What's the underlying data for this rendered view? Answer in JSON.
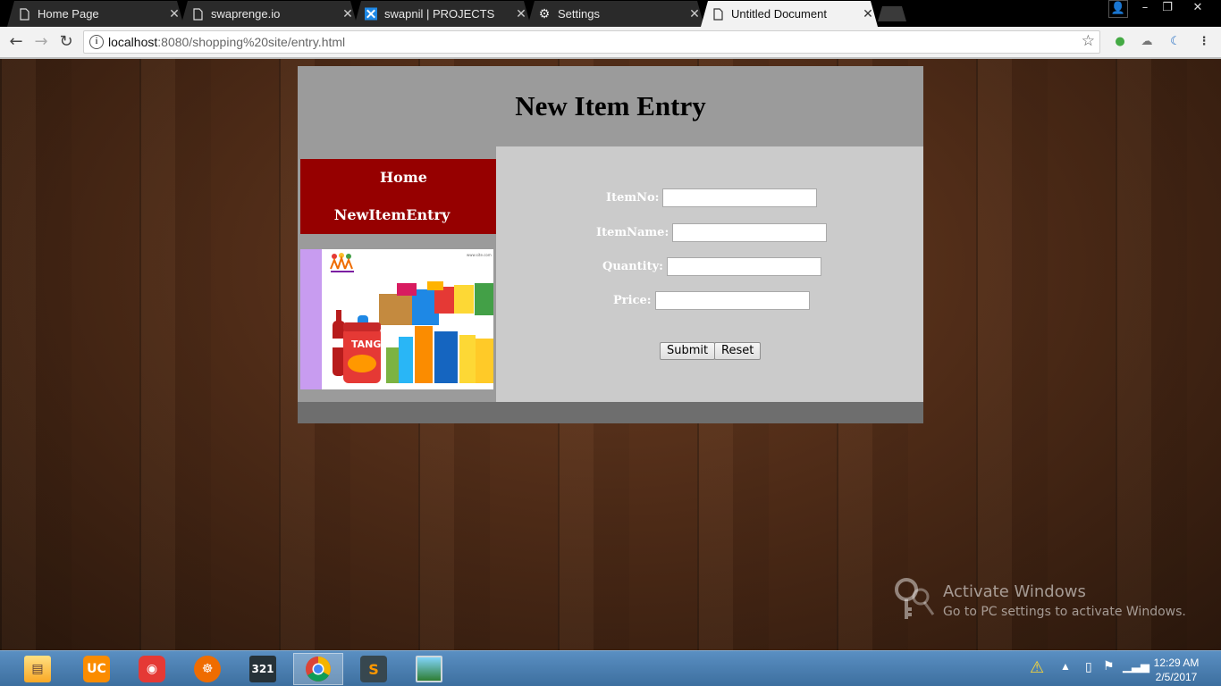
{
  "browser": {
    "tabs": [
      {
        "title": "Home Page",
        "icon": "page-icon",
        "active": false
      },
      {
        "title": "swaprenge.io",
        "icon": "page-icon",
        "active": false
      },
      {
        "title": "swapnil | PROJECTS",
        "icon": "x-logo-icon",
        "active": false
      },
      {
        "title": "Settings",
        "icon": "gear-icon",
        "active": false
      },
      {
        "title": "Untitled Document",
        "icon": "page-icon",
        "active": true
      }
    ],
    "url_host": "localhost",
    "url_rest": ":8080/shopping%20site/entry.html"
  },
  "site": {
    "heading": "New Item Entry",
    "menu": {
      "home": "Home",
      "new_item_entry": "NewItemEntry"
    },
    "form": {
      "item_no_label": "ItemNo:",
      "item_no_value": "",
      "item_name_label": "ItemName:",
      "item_name_value": "",
      "quantity_label": "Quantity:",
      "quantity_value": "",
      "price_label": "Price:",
      "price_value": "",
      "submit_label": "Submit",
      "reset_label": "Reset"
    },
    "promo_brand": "TANG",
    "colors": {
      "header_bg": "#9b9b9b",
      "menu_bg": "#960000",
      "content_bg": "#cbcbcb",
      "footer_bg": "#6e6e6e"
    }
  },
  "watermark": {
    "title": "Activate Windows",
    "subtitle": "Go to PC settings to activate Windows."
  },
  "taskbar": {
    "apps": [
      "file-explorer-icon",
      "uc-browser-icon",
      "screen-recorder-icon",
      "helm-app-icon",
      "media-player-icon",
      "chrome-icon",
      "sublime-text-icon",
      "photo-viewer-icon"
    ],
    "time": "12:29 AM",
    "date": "2/5/2017"
  }
}
